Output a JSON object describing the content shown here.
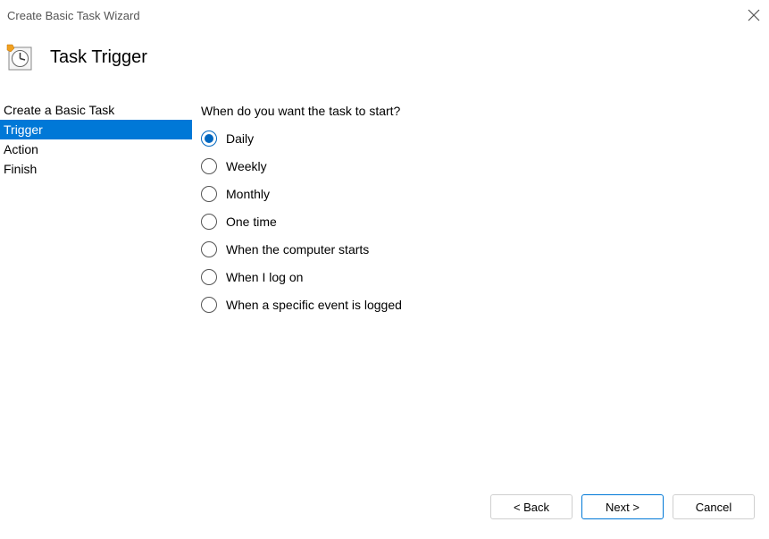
{
  "window": {
    "title": "Create Basic Task Wizard"
  },
  "header": {
    "title": "Task Trigger"
  },
  "sidebar": {
    "items": [
      {
        "label": "Create a Basic Task",
        "selected": false
      },
      {
        "label": "Trigger",
        "selected": true
      },
      {
        "label": "Action",
        "selected": false
      },
      {
        "label": "Finish",
        "selected": false
      }
    ]
  },
  "main": {
    "question": "When do you want the task to start?",
    "options": [
      {
        "label": "Daily",
        "checked": true
      },
      {
        "label": "Weekly",
        "checked": false
      },
      {
        "label": "Monthly",
        "checked": false
      },
      {
        "label": "One time",
        "checked": false
      },
      {
        "label": "When the computer starts",
        "checked": false
      },
      {
        "label": "When I log on",
        "checked": false
      },
      {
        "label": "When a specific event is logged",
        "checked": false
      }
    ]
  },
  "buttons": {
    "back": "< Back",
    "next": "Next >",
    "cancel": "Cancel"
  }
}
